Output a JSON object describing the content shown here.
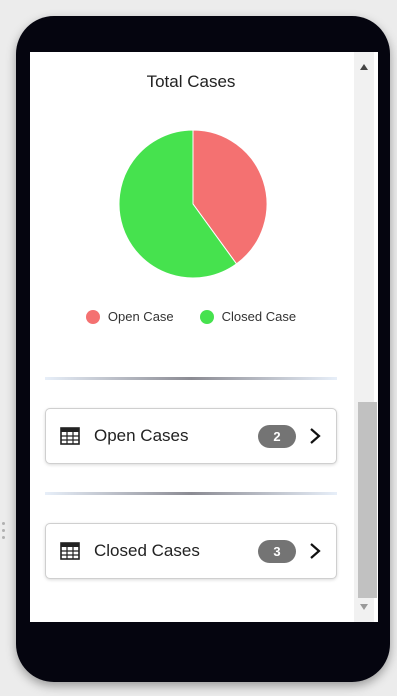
{
  "chart": {
    "title": "Total Cases"
  },
  "chart_data": {
    "type": "pie",
    "title": "Total Cases",
    "categories": [
      "Open Case",
      "Closed Case"
    ],
    "values": [
      2,
      3
    ],
    "colors": [
      "#f47171",
      "#46e24e"
    ],
    "legend_position": "bottom"
  },
  "legend": {
    "items": [
      {
        "label": "Open Case",
        "color": "#f47171"
      },
      {
        "label": "Closed Case",
        "color": "#46e24e"
      }
    ]
  },
  "cases": [
    {
      "label": "Open Cases",
      "count": "2",
      "icon": "table-grid-icon"
    },
    {
      "label": "Closed Cases",
      "count": "3",
      "icon": "table-grid-icon"
    }
  ]
}
